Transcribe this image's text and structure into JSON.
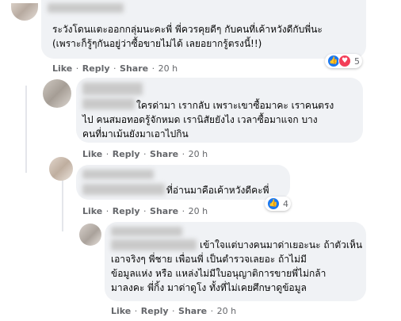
{
  "comments": [
    {
      "lines": [
        "ระวังโดนแตะออกกลุ่มนะคะพี่ พี่ควรคุยดีๆ กับคนที่เค้าหวังดีกับพี่นะ",
        "(เพราะก็รู้ๆกันอยู่ว่าซื้อขายไม่ได้ เลยอยากรู้ตรงนี้!!)"
      ],
      "reaction_count": "5",
      "time": "20 h"
    },
    {
      "lines": [
        "ใครด่ามา เรากลับ เพราะเขาซื้อมาคะ เราคนตรง",
        "ไป คนสมอทอดรู้จักหมด เรานิสัยยังไง เวลาซื้อมาแจก บาง",
        "คนที่มาเม้นยังมาเอาไปกิน"
      ],
      "time": "20 h"
    },
    {
      "lines": [
        "ที่อ่านมาคือเค้าหวังดีคะพี่"
      ],
      "reaction_count": "4",
      "time": "20 h"
    },
    {
      "lines": [
        "เข้าใจแต่บางคนมาด่าเยอะนะ ถ้าตัวเห็น",
        "เอาจริงๆ พี่ชาย เพื่อนพี่ เป็นตำรวจเลยอะ ถ้าไม่มี",
        "ข้อมูลแห่ง หรือ แหล่งไม่มีใบอนุญาติการขายพี่ไม่กล้า",
        "มาลงคะ พี่กิ้ง มาด่าดูโง ทั้งที่ไม่เคยศึกษาดูข้อมูล"
      ],
      "time": "20 h"
    }
  ],
  "actions": {
    "like": "Like",
    "reply": "Reply",
    "share": "Share",
    "sep": "·"
  },
  "icons": {
    "like": "like-icon",
    "love": "love-icon"
  },
  "colors": {
    "bubble": "#f0f2f5",
    "meta": "#65676b",
    "like": "#1877f2",
    "love": "#f33e58"
  }
}
